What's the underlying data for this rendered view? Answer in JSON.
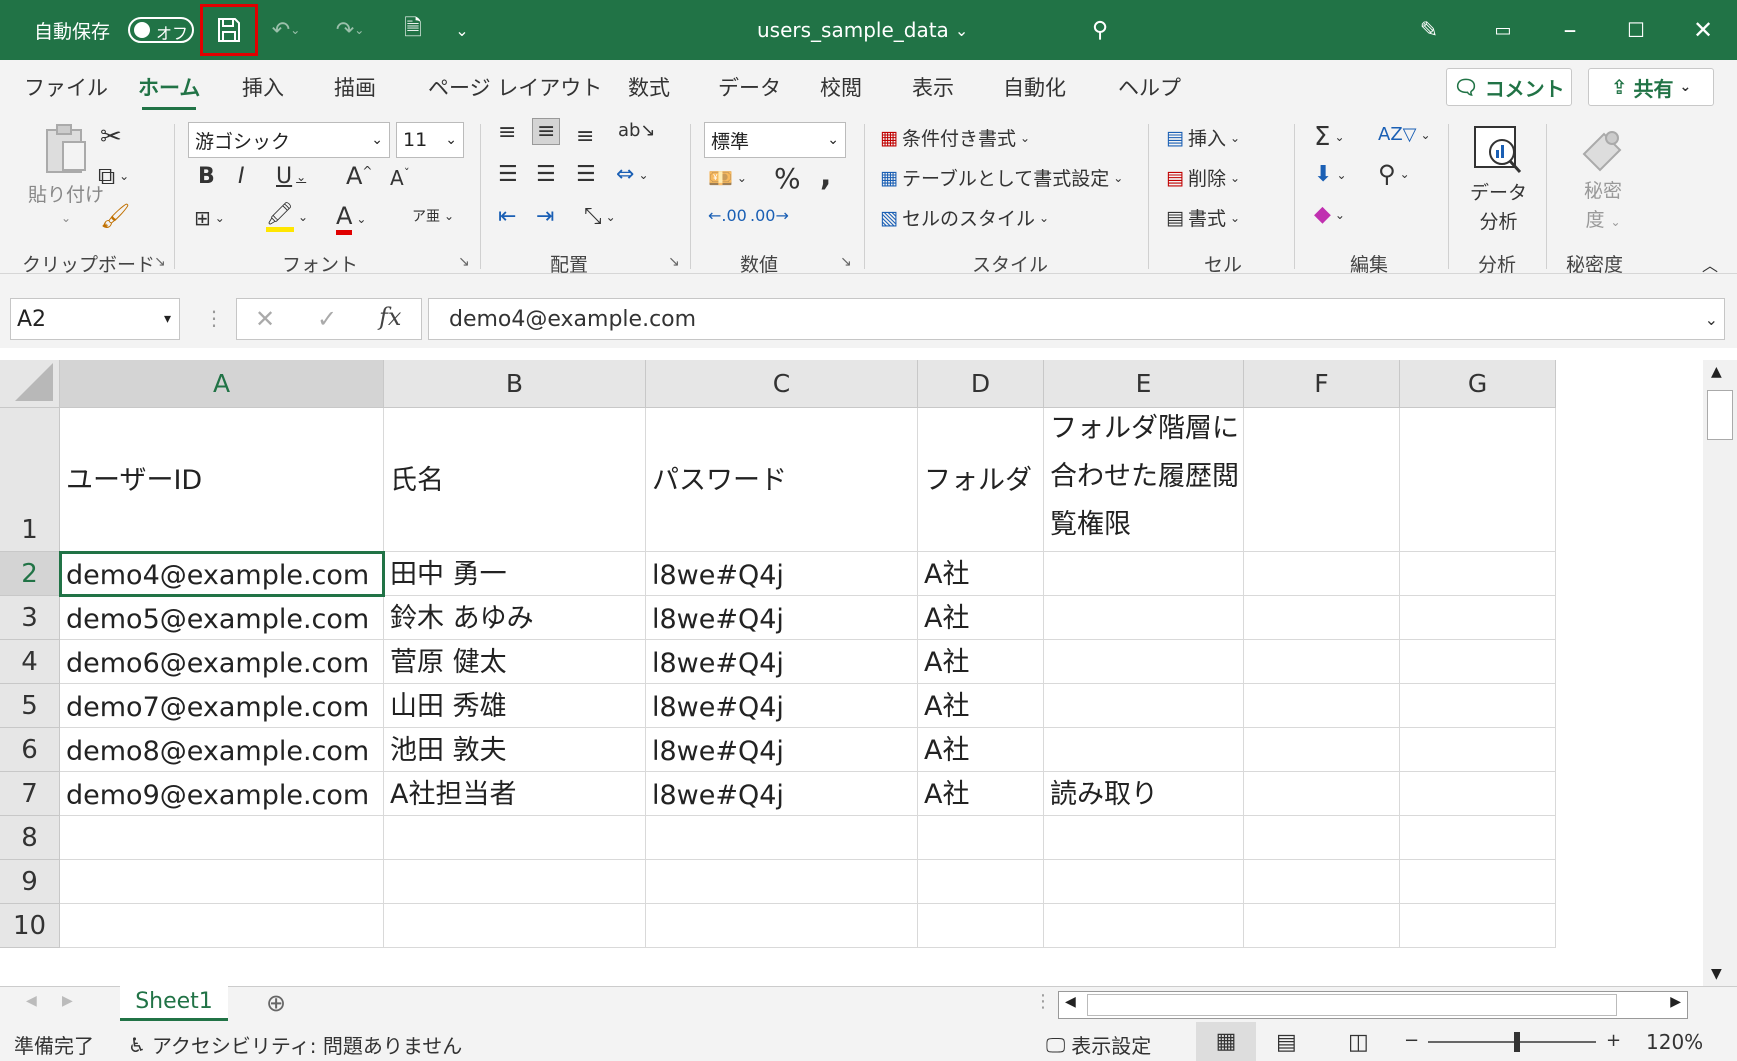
{
  "titlebar": {
    "autosave_label": "自動保存",
    "autosave_state": "オフ",
    "document_title": "users_sample_data"
  },
  "menu": {
    "tabs": [
      "ファイル",
      "ホーム",
      "挿入",
      "描画",
      "ページ レイアウト",
      "数式",
      "データ",
      "校閲",
      "表示",
      "自動化",
      "ヘルプ"
    ],
    "active_tab": "ホーム",
    "comment_button": "コメント",
    "share_button": "共有"
  },
  "ribbon": {
    "clipboard": {
      "paste": "貼り付け",
      "group": "クリップボード"
    },
    "font": {
      "name": "游ゴシック",
      "size": "11",
      "group": "フォント",
      "bold": "B",
      "italic": "I",
      "underline": "U"
    },
    "alignment": {
      "group": "配置"
    },
    "number": {
      "format": "標準",
      "group": "数値"
    },
    "styles": {
      "conditional": "条件付き書式",
      "table": "テーブルとして書式設定",
      "cell_styles": "セルのスタイル",
      "group": "スタイル"
    },
    "cells": {
      "insert": "挿入",
      "delete": "削除",
      "format": "書式",
      "group": "セル"
    },
    "editing": {
      "group": "編集"
    },
    "analysis": {
      "button_line1": "データ",
      "button_line2": "分析",
      "group": "分析"
    },
    "sensitivity": {
      "button_line1": "秘密",
      "button_line2": "度",
      "group": "秘密度"
    }
  },
  "formula_bar": {
    "name_box": "A2",
    "formula": "demo4@example.com"
  },
  "grid": {
    "columns": [
      "A",
      "B",
      "C",
      "D",
      "E",
      "F",
      "G"
    ],
    "rows": [
      "1",
      "2",
      "3",
      "4",
      "5",
      "6",
      "7",
      "8",
      "9",
      "10"
    ],
    "header": {
      "A": "ユーザーID",
      "B": "氏名",
      "C": "パスワード",
      "D": "フォルダ",
      "E": "フォルダ階層に合わせた履歴閲覧権限"
    },
    "data": [
      {
        "A": "demo4@example.com",
        "B": "田中 勇一",
        "C": "l8we#Q4j",
        "D": "A社",
        "E": ""
      },
      {
        "A": "demo5@example.com",
        "B": "鈴木 あゆみ",
        "C": "l8we#Q4j",
        "D": "A社",
        "E": ""
      },
      {
        "A": "demo6@example.com",
        "B": "菅原 健太",
        "C": "l8we#Q4j",
        "D": "A社",
        "E": ""
      },
      {
        "A": "demo7@example.com",
        "B": "山田 秀雄",
        "C": "l8we#Q4j",
        "D": "A社",
        "E": ""
      },
      {
        "A": "demo8@example.com",
        "B": "池田 敦夫",
        "C": "l8we#Q4j",
        "D": "A社",
        "E": ""
      },
      {
        "A": "demo9@example.com",
        "B": "A社担当者",
        "C": "l8we#Q4j",
        "D": "A社",
        "E": "読み取り"
      }
    ]
  },
  "sheets": {
    "active": "Sheet1"
  },
  "statusbar": {
    "ready": "準備完了",
    "accessibility": "アクセシビリティ: 問題ありません",
    "display_settings": "表示設定",
    "zoom": "120%"
  },
  "colors": {
    "accent": "#217346",
    "highlight_box": "#e00000"
  }
}
